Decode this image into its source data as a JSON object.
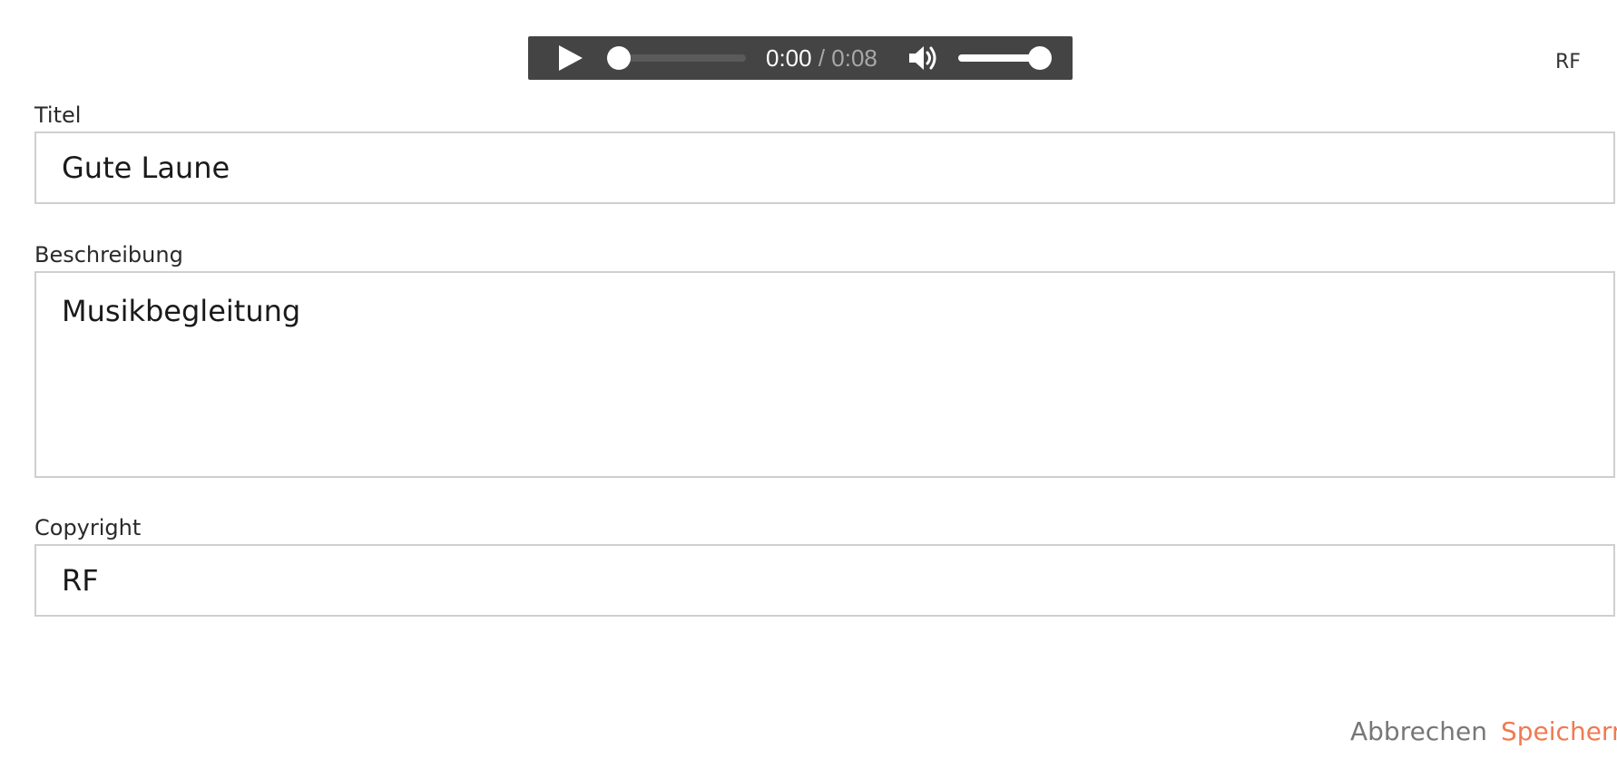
{
  "audio_player": {
    "current_time": "0:00",
    "separator": " / ",
    "duration": "0:08",
    "progress": 0.0,
    "volume": 1.0,
    "play_icon": "play-icon",
    "volume_icon": "volume-icon"
  },
  "corner_label": "RF",
  "form": {
    "title": {
      "label": "Titel",
      "value": "Gute Laune"
    },
    "description": {
      "label": "Beschreibung",
      "value": "Musikbegleitung"
    },
    "copyright": {
      "label": "Copyright",
      "value": "RF"
    }
  },
  "actions": {
    "cancel_label": "Abbrechen",
    "save_label": "Speichern"
  },
  "colors": {
    "accent": "#f07a52",
    "player_background": "#444444"
  }
}
